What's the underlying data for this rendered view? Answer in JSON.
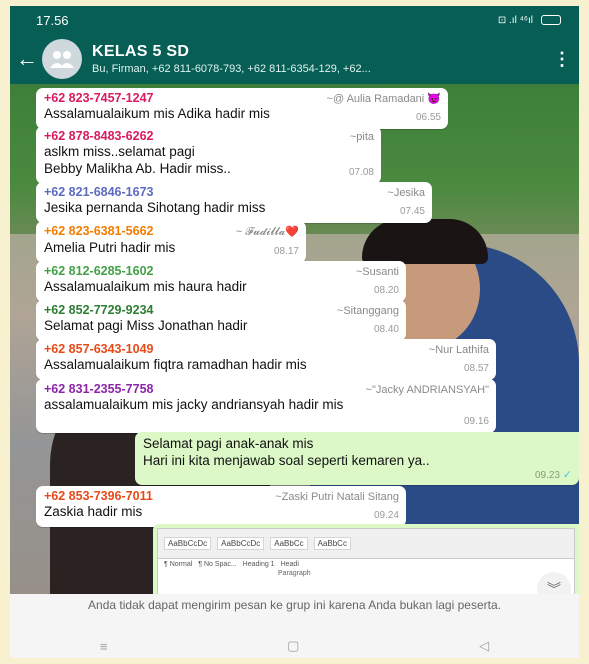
{
  "status_bar": {
    "time": "17.56",
    "icons": "⊡ .ıl ⁴⁶ıl",
    "battery": ""
  },
  "header": {
    "title": "KELAS 5 SD",
    "members": "Bu, Firman, +62 811-6078-793, +62 811-6354-129, +62..."
  },
  "messages": [
    {
      "sender": "+62 823-7457-1247",
      "sender_color": "#d81b60",
      "push_name": "~@ Aulia Ramadani 😈",
      "text": "Assalamualaikum  mis Adika hadir mis",
      "time": "06.55"
    },
    {
      "sender": "+62 878-8483-6262",
      "sender_color": "#d81b60",
      "push_name": "~pita",
      "text": "aslkm miss..selamat pagi\nBebby Malikha Ab. Hadir miss..",
      "time": "07.08"
    },
    {
      "sender": "+62 821-6846-1673",
      "sender_color": "#5c6bc0",
      "push_name": "~Jesika",
      "text": "Jesika pernanda Sihotang hadir miss",
      "time": "07.45"
    },
    {
      "sender": "+62 823-6381-5662",
      "sender_color": "#f57c00",
      "push_name": "~ 𝓕𝓾𝓭𝓲𝓵𝓵𝓪❤️",
      "text": "Amelia Putri hadir mis",
      "time": "08.17"
    },
    {
      "sender": "+62 812-6285-1602",
      "sender_color": "#43a047",
      "push_name": "~Susanti",
      "text": "Assalamualaikum mis haura hadir",
      "time": "08.20"
    },
    {
      "sender": "+62 852-7729-9234",
      "sender_color": "#2e7d32",
      "push_name": "~Sitanggang",
      "text": "Selamat pagi Miss Jonathan hadir",
      "time": "08.40"
    },
    {
      "sender": "+62 857-6343-1049",
      "sender_color": "#e64a19",
      "push_name": "~Nur Lathifa",
      "text": "Assalamualaikum fiqtra ramadhan hadir mis",
      "time": "08.57"
    },
    {
      "sender": "+62 831-2355-7758",
      "sender_color": "#8e24aa",
      "push_name": "~\"Jacky ANDRIANSYAH\"",
      "text": "assalamualaikum mis jacky andriansyah hadir mis",
      "time": "09.16"
    },
    {
      "text": "Selamat pagi anak-anak mis\nHari ini kita menjawab soal seperti kemaren ya..",
      "time": "09.23",
      "ticks": "✓"
    },
    {
      "sender": "+62 853-7396-7011",
      "sender_color": "#e64a19",
      "push_name": "~Zaski Putri Natali Sitang",
      "text": "Zaskia hadir mis",
      "time": "09.24"
    }
  ],
  "document_preview": {
    "styles": [
      "AaBbCcDc",
      "AaBbCcDc",
      "AaBbCc",
      "AaBbCc"
    ],
    "style_names": [
      "¶ Normal",
      "¶ No Spac...",
      "Heading 1",
      "Headi"
    ],
    "paragraph_label": "Paragraph"
  },
  "notice": "Anda tidak dapat mengirim pesan ke grup ini karena Anda bukan lagi peserta.",
  "nav": {
    "menu": "≡",
    "home": "▢",
    "back": "◁"
  },
  "colors": {
    "header_bg": "#075e54",
    "outgoing_bubble": "#dcf8c6",
    "incoming_bubble": "#ffffff"
  }
}
